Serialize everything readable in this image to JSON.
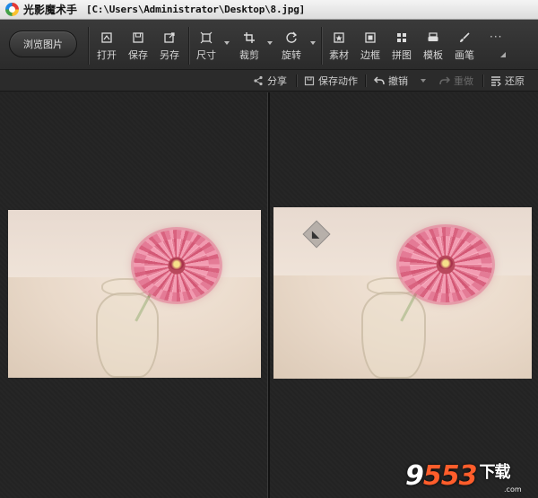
{
  "window": {
    "app_name": "光影魔术手",
    "file_path": "[C:\\Users\\Administrator\\Desktop\\8.jpg]"
  },
  "toolbar": {
    "browse_label": "浏览图片",
    "items": [
      {
        "label": "打开",
        "icon": "open-icon"
      },
      {
        "label": "保存",
        "icon": "save-icon"
      },
      {
        "label": "另存",
        "icon": "save-as-icon"
      },
      {
        "label": "尺寸",
        "icon": "resize-icon"
      },
      {
        "label": "裁剪",
        "icon": "crop-icon"
      },
      {
        "label": "旋转",
        "icon": "rotate-icon"
      },
      {
        "label": "素材",
        "icon": "material-icon"
      },
      {
        "label": "边框",
        "icon": "border-icon"
      },
      {
        "label": "拼图",
        "icon": "collage-icon"
      },
      {
        "label": "模板",
        "icon": "template-icon"
      },
      {
        "label": "画笔",
        "icon": "brush-icon"
      }
    ],
    "more": "···"
  },
  "subbar": {
    "share": "分享",
    "save_action": "保存动作",
    "undo": "撤销",
    "redo": "重做",
    "restore": "还原"
  },
  "panels": {
    "left_label": "original",
    "right_label": "preview"
  },
  "watermark": {
    "digits_white": "9",
    "digits_red": "553",
    "suffix": "下载",
    "sub": ".com"
  },
  "colors": {
    "background": "#242424",
    "toolbar": "#333333",
    "flower_pink": "#e47b96"
  }
}
